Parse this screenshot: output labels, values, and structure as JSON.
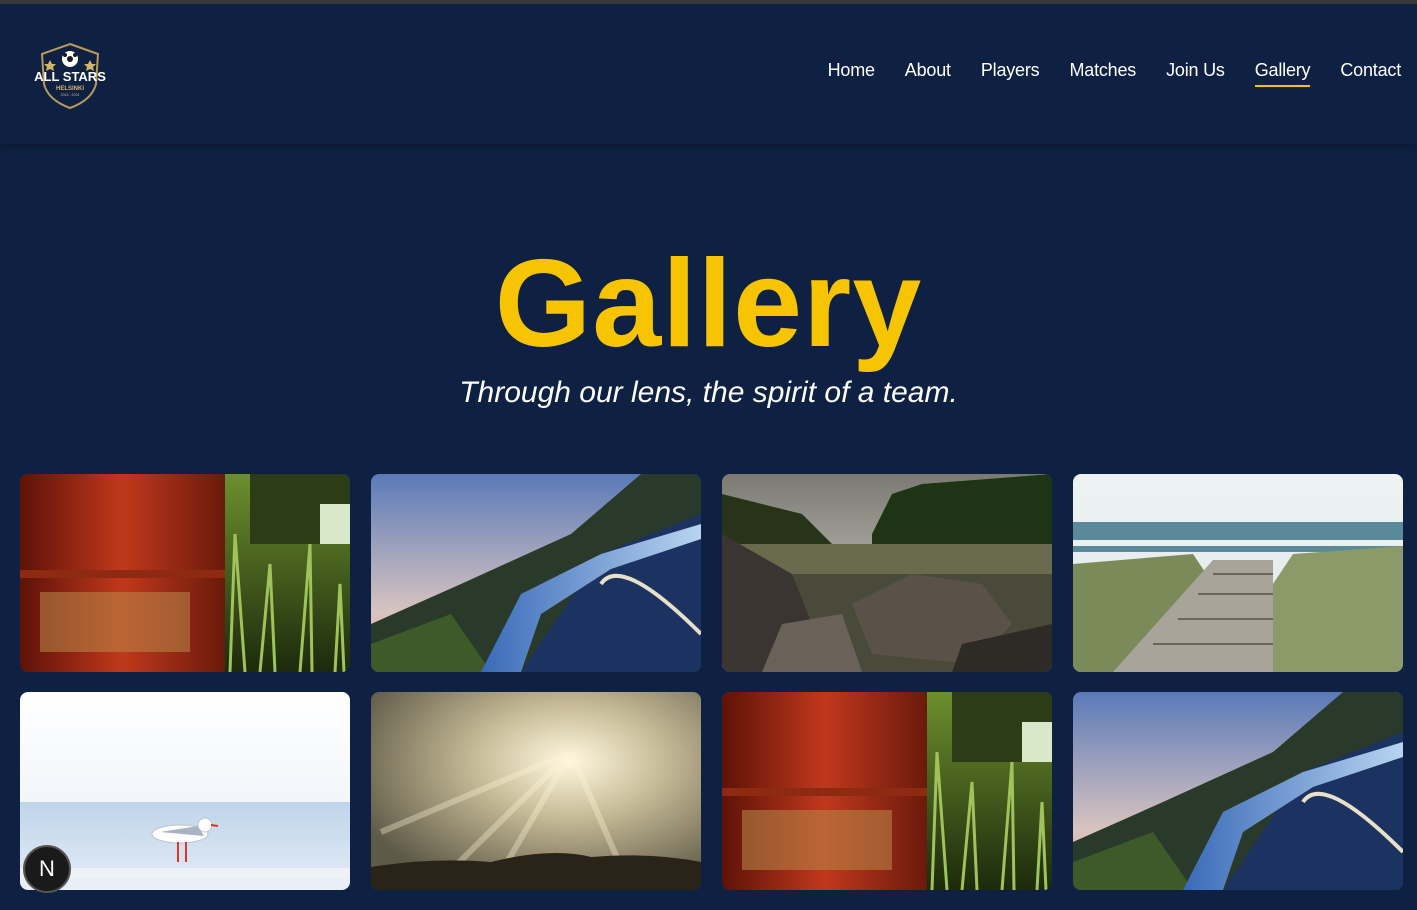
{
  "brand": {
    "name": "ALL STARS",
    "city": "HELSINKI",
    "years": "2015 - 2024"
  },
  "nav": {
    "items": [
      {
        "label": "Home",
        "active": false
      },
      {
        "label": "About",
        "active": false
      },
      {
        "label": "Players",
        "active": false
      },
      {
        "label": "Matches",
        "active": false
      },
      {
        "label": "Join Us",
        "active": false
      },
      {
        "label": "Gallery",
        "active": true
      },
      {
        "label": "Contact",
        "active": false
      }
    ]
  },
  "hero": {
    "title": "Gallery",
    "subtitle": "Through our lens, the spirit of a team."
  },
  "gallery": {
    "images": [
      {
        "subject": "red-barrel-grass"
      },
      {
        "subject": "mountain-road-railing"
      },
      {
        "subject": "river-rocks-forest"
      },
      {
        "subject": "boardwalk-to-sea"
      },
      {
        "subject": "seagull-on-railing"
      },
      {
        "subject": "sunrays-over-hills"
      },
      {
        "subject": "red-barrel-grass"
      },
      {
        "subject": "mountain-road-railing"
      }
    ]
  },
  "dev_badge": {
    "label": "N"
  },
  "colors": {
    "background": "#0e2143",
    "accent": "#f6c400",
    "text": "#ffffff"
  }
}
